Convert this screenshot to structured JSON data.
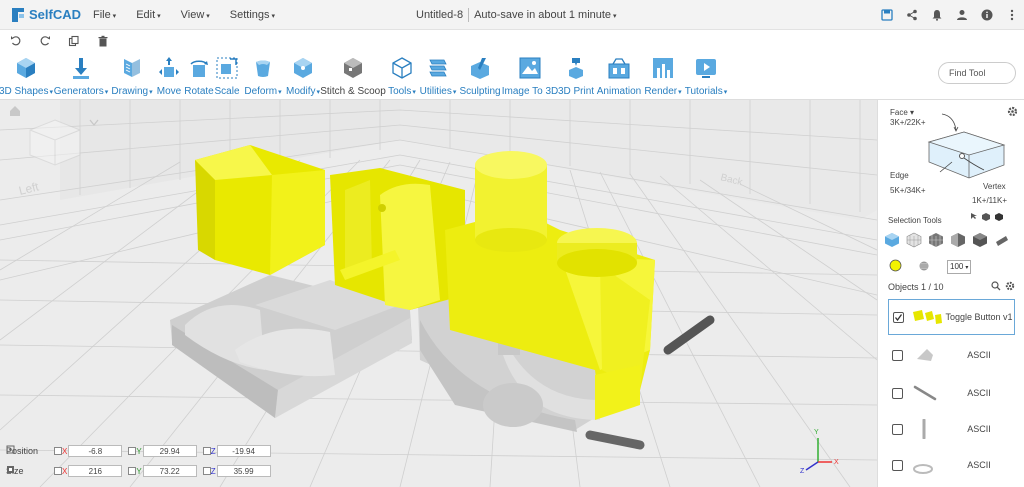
{
  "app": {
    "name": "SelfCAD"
  },
  "menu": [
    "File",
    "Edit",
    "View",
    "Settings"
  ],
  "document": {
    "title": "Untitled-8",
    "autosave": "Auto-save in about 1 minute"
  },
  "find_tool": {
    "placeholder": "Find Tool"
  },
  "toolbar": [
    {
      "label": "3D Shapes",
      "dropdown": true,
      "icon": "cube-icon"
    },
    {
      "label": "Generators",
      "dropdown": true,
      "icon": "generator-icon"
    },
    {
      "label": "Drawing",
      "dropdown": true,
      "icon": "drawing-icon"
    },
    {
      "label": "Move",
      "dropdown": false,
      "icon": "move-icon"
    },
    {
      "label": "Rotate",
      "dropdown": false,
      "icon": "rotate-icon"
    },
    {
      "label": "Scale",
      "dropdown": false,
      "icon": "scale-icon"
    },
    {
      "label": "Deform",
      "dropdown": true,
      "icon": "deform-icon"
    },
    {
      "label": "Modify",
      "dropdown": true,
      "icon": "modify-icon"
    },
    {
      "label": "Stitch & Scoop",
      "dropdown": false,
      "icon": "stitch-scoop-icon"
    },
    {
      "label": "Tools",
      "dropdown": true,
      "icon": "tools-icon"
    },
    {
      "label": "Utilities",
      "dropdown": true,
      "icon": "utilities-icon"
    },
    {
      "label": "Sculpting",
      "dropdown": false,
      "icon": "sculpting-icon"
    },
    {
      "label": "Image To 3D",
      "dropdown": false,
      "icon": "image-to-3d-icon"
    },
    {
      "label": "3D Print",
      "dropdown": false,
      "icon": "3d-print-icon"
    },
    {
      "label": "Animation",
      "dropdown": false,
      "icon": "animation-icon"
    },
    {
      "label": "Render",
      "dropdown": true,
      "icon": "render-icon"
    },
    {
      "label": "Tutorials",
      "dropdown": true,
      "icon": "tutorials-icon"
    }
  ],
  "transform": {
    "position": {
      "label": "Position",
      "x": "-6.8",
      "y": "29.94",
      "z": "-19.94"
    },
    "size": {
      "label": "Size",
      "x": "216",
      "y": "73.22",
      "z": "35.99"
    }
  },
  "panel": {
    "face_label": "Face",
    "face_count": "3K+/22K+",
    "edge_label": "Edge",
    "edge_count": "5K+/34K+",
    "vertex_label": "Vertex",
    "vertex_count": "1K+/11K+",
    "selection_tools": "Selection Tools",
    "brush_size": "100",
    "objects_label": "Objects 1 / 10",
    "objects": [
      {
        "name": "Toggle Button v1",
        "checked": true,
        "selected": true
      },
      {
        "name": "ASCII",
        "checked": false,
        "selected": false
      },
      {
        "name": "ASCII",
        "checked": false,
        "selected": false
      },
      {
        "name": "ASCII",
        "checked": false,
        "selected": false
      },
      {
        "name": "ASCII",
        "checked": false,
        "selected": false
      }
    ]
  },
  "colors": {
    "brand": "#2a7fc0",
    "model_yellow": "#f2f21a",
    "model_gray": "#d4d4d4",
    "grid_bg": "#ececec"
  }
}
